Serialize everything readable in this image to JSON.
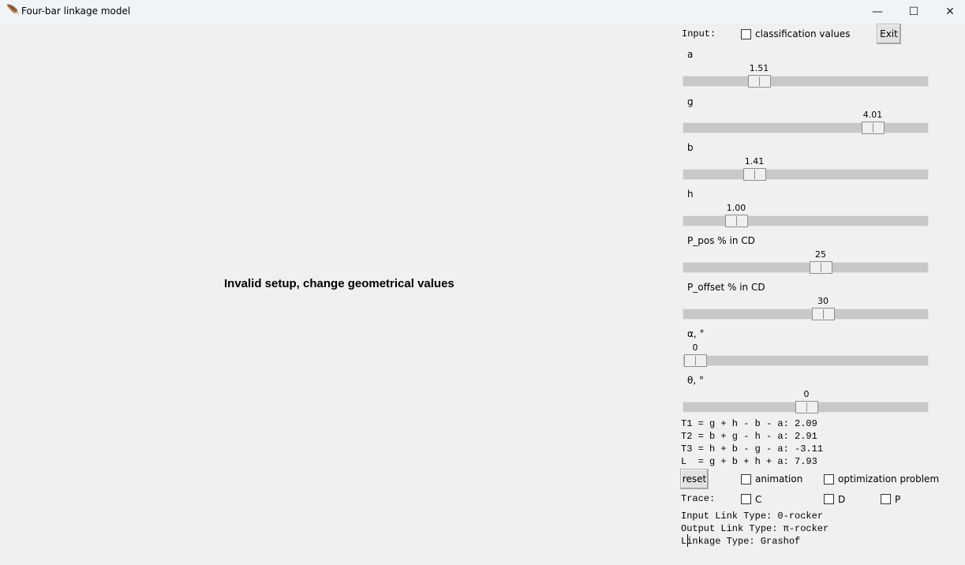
{
  "window": {
    "title": "Four-bar linkage model",
    "minimize_glyph": "—",
    "maximize_glyph": "☐",
    "close_glyph": "✕"
  },
  "canvas": {
    "message": "Invalid setup, change geometrical values"
  },
  "panel": {
    "input_label": "Input:",
    "classification_label": "classification values",
    "exit_label": "Exit",
    "sliders": [
      {
        "label": "a",
        "value": "1.51"
      },
      {
        "label": "g",
        "value": "4.01"
      },
      {
        "label": "b",
        "value": "1.41"
      },
      {
        "label": "h",
        "value": "1.00"
      },
      {
        "label": "P_pos % in CD",
        "value": "25"
      },
      {
        "label": "P_offset % in CD",
        "value": "30"
      },
      {
        "label": "α, °",
        "value": "0"
      },
      {
        "label": "θ, °",
        "value": "0"
      }
    ],
    "equations": [
      "T1 = g + h - b - a: 2.09",
      "T2 = b + g - h - a: 2.91",
      "T3 = h + b - g - a: -3.11",
      "L  = g + b + h + a: 7.93"
    ],
    "reset_label": "reset",
    "animation_label": "animation",
    "optimization_label": "optimization problem",
    "trace_label": "Trace:",
    "trace_options": [
      "C",
      "D",
      "P"
    ],
    "status": [
      "Input Link Type: 0-rocker",
      "Output Link Type: π-rocker",
      "Linkage Type: Grashof"
    ]
  }
}
